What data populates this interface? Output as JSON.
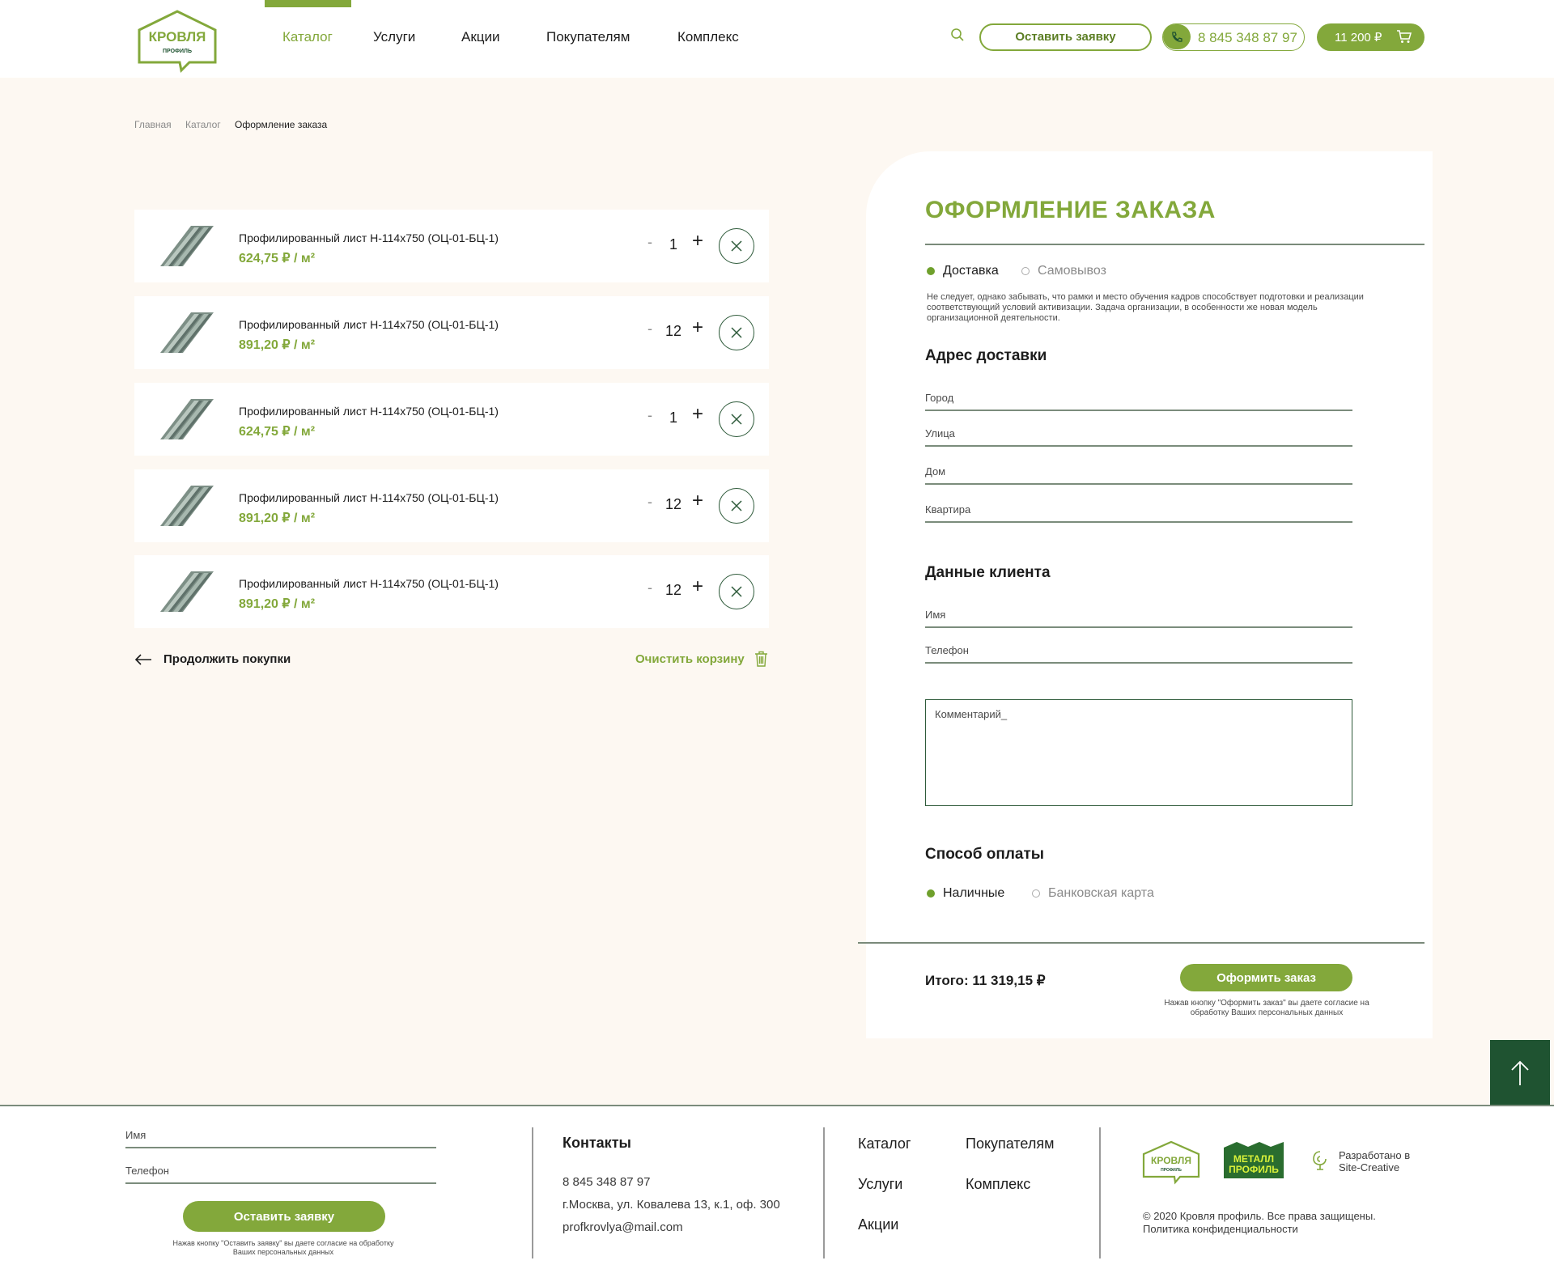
{
  "colors": {
    "accent": "#83a83b",
    "dark_green": "#1f5331",
    "background": "#fdf8f2"
  },
  "header": {
    "logo": {
      "line1": "КРОВЛЯ",
      "line2": "ПРОФИЛЬ"
    },
    "nav": [
      "Каталог",
      "Услуги",
      "Акции",
      "Покупателям",
      "Комплекс"
    ],
    "active_nav": "Каталог",
    "request_button": "Оставить заявку",
    "phone": "8 845 348 87 97",
    "cart_total": "11 200 ₽",
    "icons": [
      "search-icon",
      "phone-icon",
      "cart-icon"
    ]
  },
  "breadcrumbs": [
    "Главная",
    "Каталог",
    "Оформление заказа"
  ],
  "cart": {
    "items": [
      {
        "name": "Профилированный лист Н-114х750 (ОЦ-01-БЦ-1)",
        "price": "624,75 ₽ / м²",
        "qty": "1",
        "minus": "-",
        "plus": "+"
      },
      {
        "name": "Профилированный лист Н-114х750 (ОЦ-01-БЦ-1)",
        "price": "891,20 ₽ / м²",
        "qty": "12",
        "minus": "-",
        "plus": "+"
      },
      {
        "name": "Профилированный лист Н-114х750 (ОЦ-01-БЦ-1)",
        "price": "624,75 ₽ / м²",
        "qty": "1",
        "minus": "-",
        "plus": "+"
      },
      {
        "name": "Профилированный лист Н-114х750 (ОЦ-01-БЦ-1)",
        "price": "891,20 ₽ / м²",
        "qty": "12",
        "minus": "-",
        "plus": "+"
      },
      {
        "name": "Профилированный лист Н-114х750 (ОЦ-01-БЦ-1)",
        "price": "891,20 ₽ / м²",
        "qty": "12",
        "minus": "-",
        "plus": "+"
      }
    ],
    "continue_label": "Продолжить покупки",
    "clear_label": "Очистить корзину"
  },
  "order": {
    "title": "ОФОРМЛЕНИЕ ЗАКАЗА",
    "delivery_options": [
      "Доставка",
      "Самовывоз"
    ],
    "delivery_selected": "Доставка",
    "note": "Не следует, однако забывать, что рамки и место обучения кадров способствует подготовки и реализации соответствующий условий активизации. Задача организации, в особенности же новая модель организационной деятельности.",
    "address_title": "Адрес доставки",
    "address_fields": [
      "Город",
      "Улица",
      "Дом",
      "Квартира"
    ],
    "client_title": "Данные клиента",
    "client_fields": [
      "Имя",
      "Телефон"
    ],
    "comment_placeholder": "Комментарий_",
    "payment_title": "Способ оплаты",
    "payment_options": [
      "Наличные",
      "Банковская карта"
    ],
    "payment_selected": "Наличные",
    "total": "Итого: 11 319,15 ₽",
    "submit_label": "Оформить заказ",
    "consent": "Нажав кнопку \"Оформить заказ\" вы даете согласие на обработку Ваших персональных данных"
  },
  "footer": {
    "form_fields": [
      "Имя",
      "Телефон"
    ],
    "form_button": "Оставить заявку",
    "form_consent": "Нажав кнопку \"Оставить заявку\" вы даете согласие на обработку Ваших персональных данных",
    "contacts_title": "Контакты",
    "phone": "8 845 348 87 97",
    "address": "г.Москва, ул. Ковалева 13, к.1, оф. 300",
    "email": "profkrovlya@mail.com",
    "links": [
      "Каталог",
      "Покупателям",
      "Услуги",
      "Комплекс",
      "Акции"
    ],
    "logo_krovlya": {
      "line1": "КРОВЛЯ",
      "line2": "ПРОФИЛЬ"
    },
    "logo_metall": {
      "line1": "МЕТАЛЛ",
      "line2": "ПРОФИЛЬ"
    },
    "developer_line1": "Разработано в",
    "developer_line2": "Site-Creative",
    "copyright": "© 2020 Кровля профиль. Все права защищены.",
    "privacy": "Политика конфиденциальности"
  }
}
